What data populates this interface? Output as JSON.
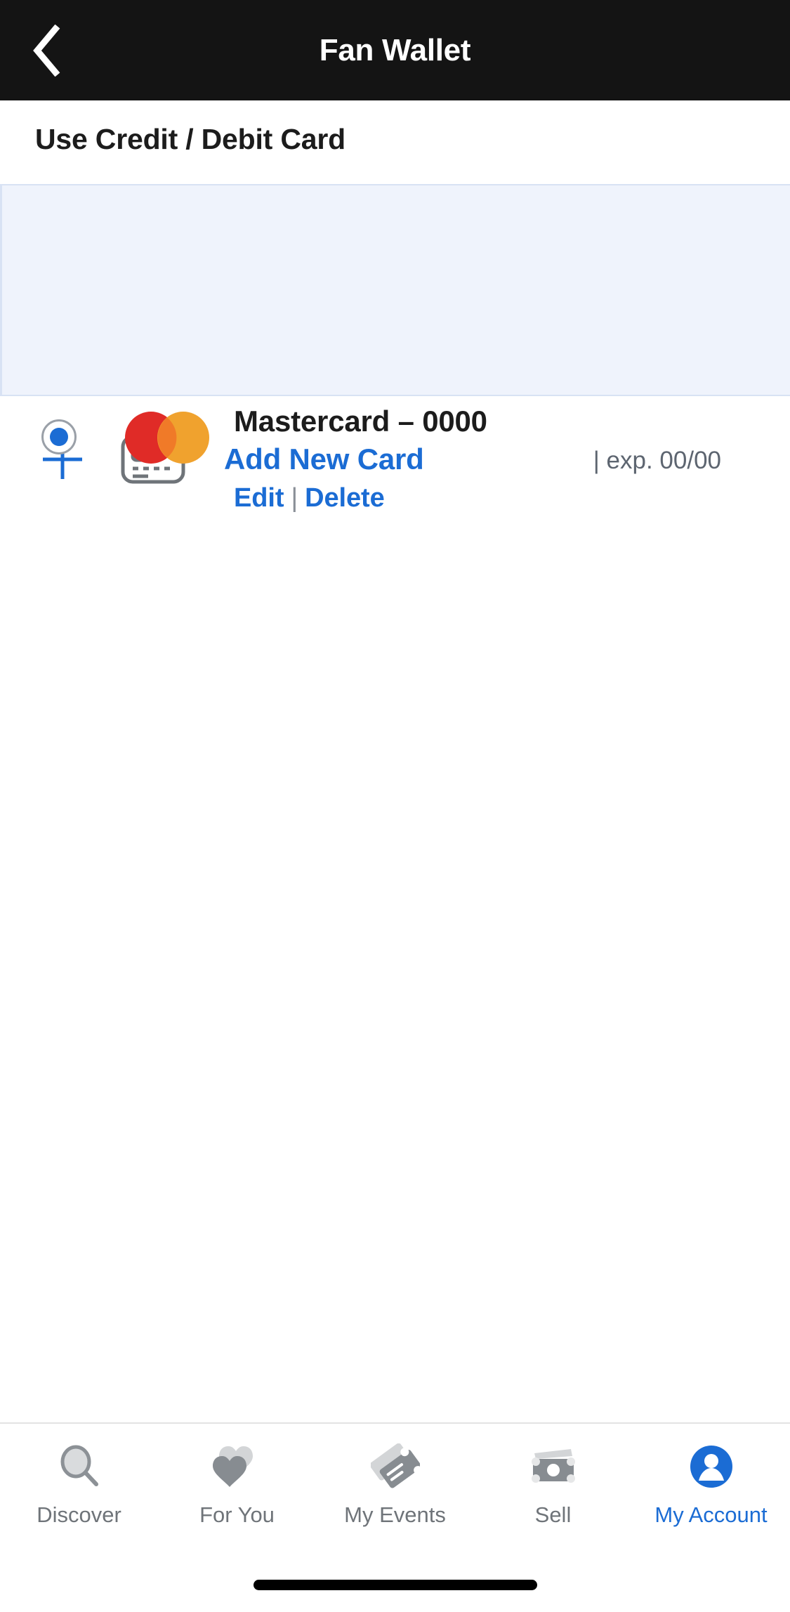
{
  "navbar": {
    "title": "Fan Wallet",
    "back_icon": "chevron-left-icon"
  },
  "section": {
    "heading": "Use Credit / Debit Card"
  },
  "saved_card": {
    "selected": true,
    "brand_icon": "mastercard-logo",
    "name": "Mastercard – 0000",
    "expiry": "| exp. 00/00",
    "edit_label": "Edit",
    "separator": "|",
    "delete_label": "Delete"
  },
  "add_card": {
    "plus_icon": "plus-icon",
    "card_icon": "credit-card-icon",
    "label": "Add New Card"
  },
  "tabbar": {
    "items": [
      {
        "label": "Discover",
        "icon": "search-icon",
        "active": false
      },
      {
        "label": "For You",
        "icon": "hearts-icon",
        "active": false
      },
      {
        "label": "My Events",
        "icon": "tickets-icon",
        "active": false
      },
      {
        "label": "Sell",
        "icon": "money-icon",
        "active": false
      },
      {
        "label": "My Account",
        "icon": "person-icon",
        "active": true
      }
    ]
  },
  "colors": {
    "accent_blue": "#1B6CD4",
    "navbar_black": "#141414",
    "panel_blue": "#EFF3FC",
    "panel_border": "#D8E2F4",
    "mastercard_red": "#E02B27",
    "mastercard_yellow": "#F0A22E",
    "mastercard_overlap": "#F07A28",
    "tab_inactive": "#6F7479"
  }
}
